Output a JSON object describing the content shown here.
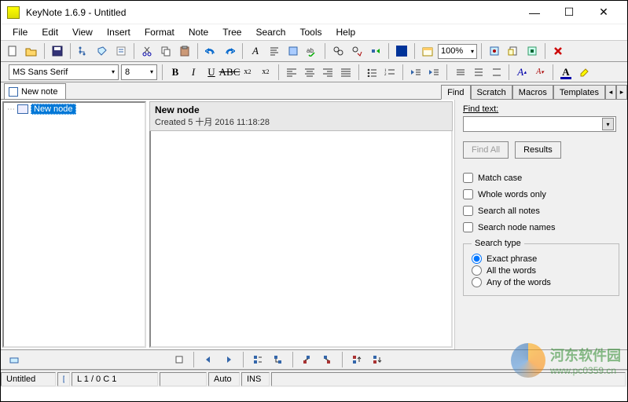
{
  "window": {
    "title": "KeyNote 1.6.9 - Untitled",
    "min": "—",
    "max": "☐",
    "close": "✕"
  },
  "menu": [
    "File",
    "Edit",
    "View",
    "Insert",
    "Format",
    "Note",
    "Tree",
    "Search",
    "Tools",
    "Help"
  ],
  "format": {
    "font": "MS Sans Serif",
    "size": "8",
    "zoom": "100%"
  },
  "tabs": {
    "note": "New note"
  },
  "tree": {
    "root": "New node"
  },
  "editor": {
    "title": "New node",
    "created": "Created 5 十月 2016 11:18:28"
  },
  "panel": {
    "items": [
      "Find",
      "Scratch",
      "Macros",
      "Templates"
    ],
    "find_label": "Find text:",
    "find_all": "Find All",
    "results": "Results",
    "match_case": "Match case",
    "whole_words": "Whole words only",
    "all_notes": "Search all notes",
    "node_names": "Search node names",
    "search_type": "Search type",
    "exact": "Exact phrase",
    "allw": "All the words",
    "anyw": "Any of the words"
  },
  "status": {
    "file": "Untitled",
    "pos": "L 1 / 0  C 1",
    "auto": "Auto",
    "ins": "INS"
  },
  "watermark": {
    "text": "河东软件园",
    "url": "www.pc0359.cn"
  }
}
